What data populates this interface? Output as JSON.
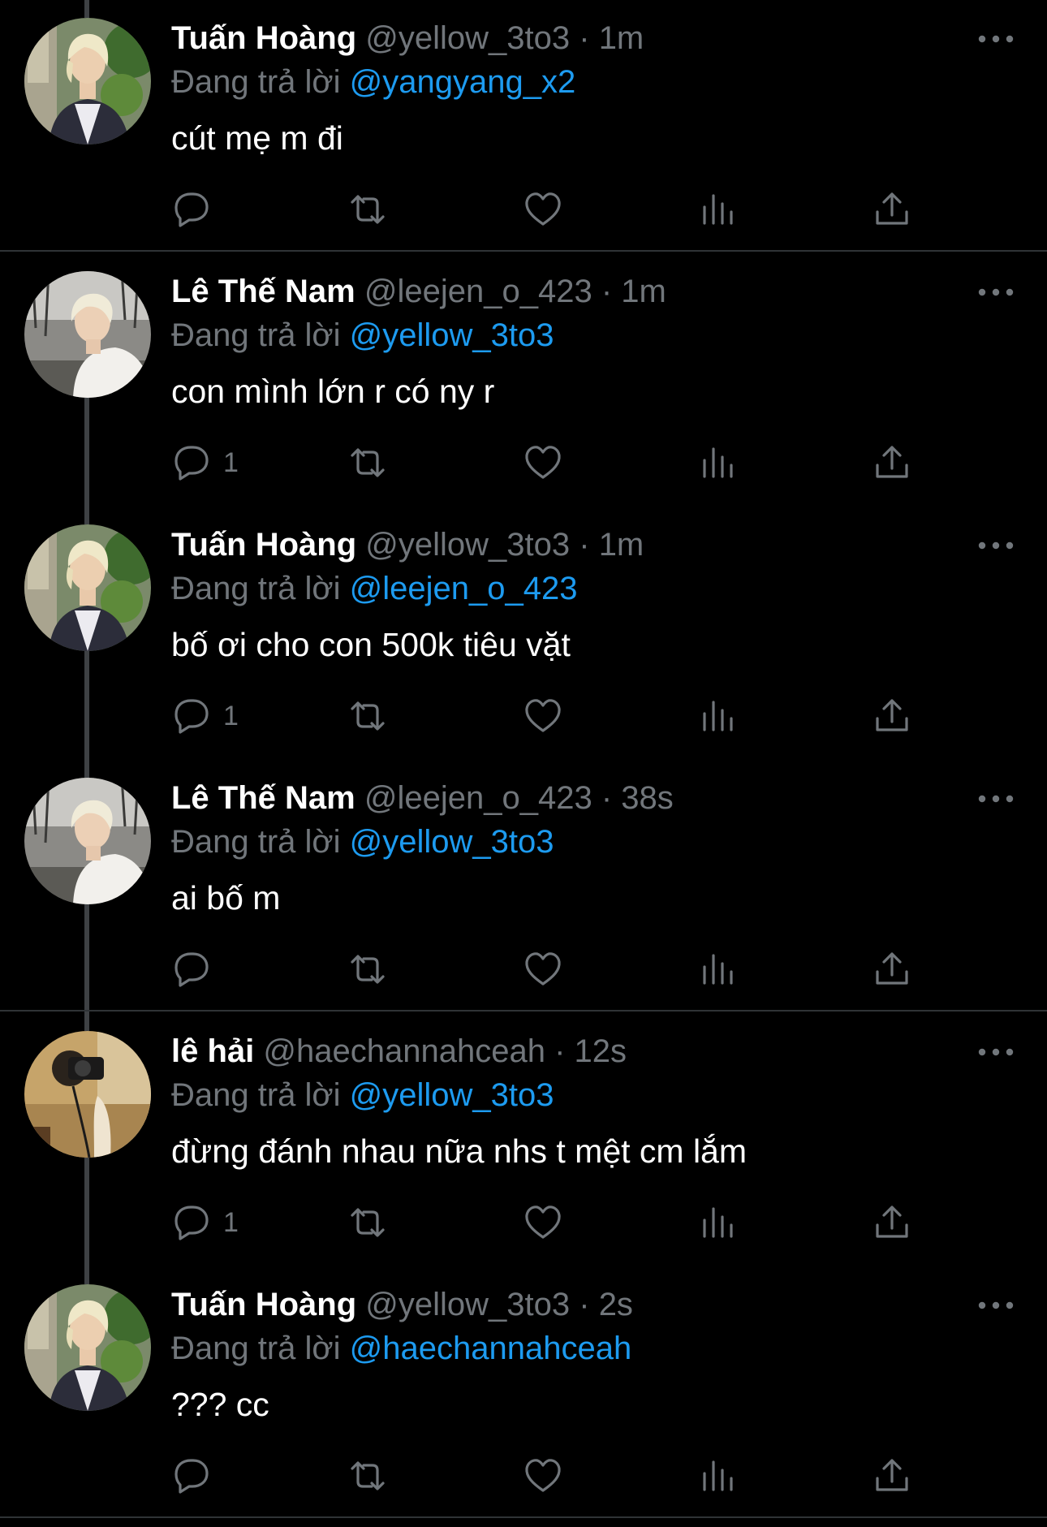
{
  "colors": {
    "background": "#000000",
    "text_primary": "#ffffff",
    "text_secondary": "#71767b",
    "link": "#1d9bf0",
    "divider": "#2f3336",
    "thread_line": "#3e4144"
  },
  "icons": {
    "more": "more-horizontal-icon",
    "reply": "reply-bubble-icon",
    "retweet": "retweet-icon",
    "like": "heart-icon",
    "views": "views-bar-chart-icon",
    "share": "share-upload-icon"
  },
  "tweets": [
    {
      "display_name": "Tuấn Hoàng",
      "handle": "@yellow_3to3",
      "separator": "·",
      "time": "1m",
      "reply_prefix": "Đang trả lời",
      "reply_to": "@yangyang_x2",
      "text": "cút mẹ m đi",
      "reply_count": "",
      "avatar": "tuan-hoang-avatar"
    },
    {
      "display_name": "Lê Thế Nam",
      "handle": "@leejen_o_423",
      "separator": "·",
      "time": "1m",
      "reply_prefix": "Đang trả lời",
      "reply_to": "@yellow_3to3",
      "text": "con mình lớn r có ny r",
      "reply_count": "1",
      "avatar": "le-the-nam-avatar"
    },
    {
      "display_name": "Tuấn Hoàng",
      "handle": "@yellow_3to3",
      "separator": "·",
      "time": "1m",
      "reply_prefix": "Đang trả lời",
      "reply_to": "@leejen_o_423",
      "text": "bố ơi cho con 500k tiêu vặt",
      "reply_count": "1",
      "avatar": "tuan-hoang-avatar"
    },
    {
      "display_name": "Lê Thế Nam",
      "handle": "@leejen_o_423",
      "separator": "·",
      "time": "38s",
      "reply_prefix": "Đang trả lời",
      "reply_to": "@yellow_3to3",
      "text": "ai bố m",
      "reply_count": "",
      "avatar": "le-the-nam-avatar"
    },
    {
      "display_name": "lê hải",
      "handle": "@haechannahceah",
      "separator": "·",
      "time": "12s",
      "reply_prefix": "Đang trả lời",
      "reply_to": "@yellow_3to3",
      "text": "đừng đánh nhau nữa nhs t mệt cm lắm",
      "reply_count": "1",
      "avatar": "le-hai-avatar"
    },
    {
      "display_name": "Tuấn Hoàng",
      "handle": "@yellow_3to3",
      "separator": "·",
      "time": "2s",
      "reply_prefix": "Đang trả lời",
      "reply_to": "@haechannahceah",
      "text": "??? cc",
      "reply_count": "",
      "avatar": "tuan-hoang-avatar"
    }
  ]
}
